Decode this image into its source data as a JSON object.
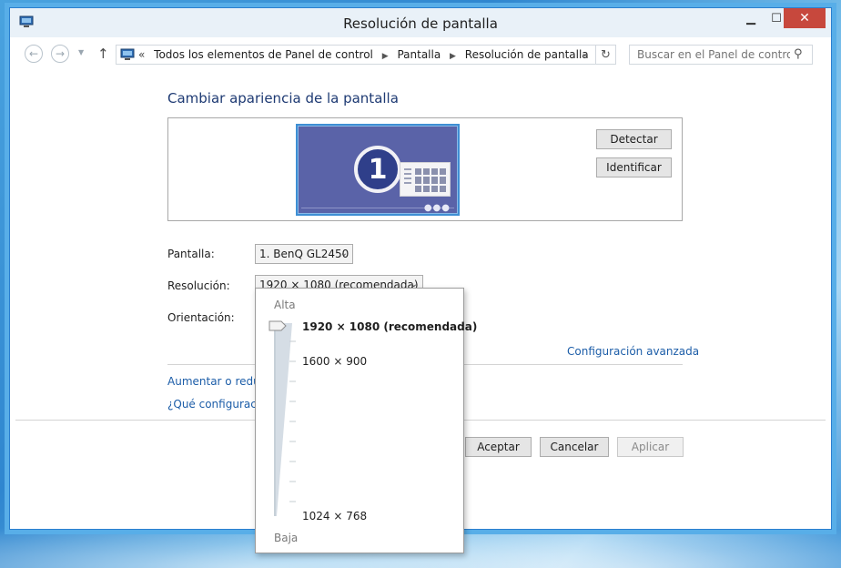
{
  "window": {
    "title": "Resolución de pantalla"
  },
  "nav": {
    "breadcrumb": [
      "Todos los elementos de Panel de control",
      "Pantalla",
      "Resolución de pantalla"
    ],
    "search_placeholder": "Buscar en el Panel de control"
  },
  "main": {
    "heading": "Cambiar apariencia de la pantalla",
    "monitor_number": "1",
    "detect_label": "Detectar",
    "identify_label": "Identificar",
    "display_label": "Pantalla:",
    "display_value": "1. BenQ GL2450",
    "resolution_label": "Resolución:",
    "resolution_value": "1920 × 1080 (recomendada)",
    "orientation_label": "Orientación:",
    "advanced_link": "Configuración avanzada",
    "resize_link": "Aumentar o reduc",
    "which_link": "¿Qué configuració"
  },
  "footer": {
    "accept_label": "Aceptar",
    "cancel_label": "Cancelar",
    "apply_label": "Aplicar"
  },
  "resolution_popup": {
    "high_label": "Alta",
    "low_label": "Baja",
    "options": [
      "1920 × 1080 (recomendada)",
      "1600 × 900",
      "1024 × 768"
    ],
    "selected": "1920 × 1080 (recomendada)"
  },
  "colors": {
    "accent": "#1c5da8",
    "heading": "#1e3a73",
    "close_button": "#c7483d",
    "monitor_fill": "#5a63a8"
  }
}
